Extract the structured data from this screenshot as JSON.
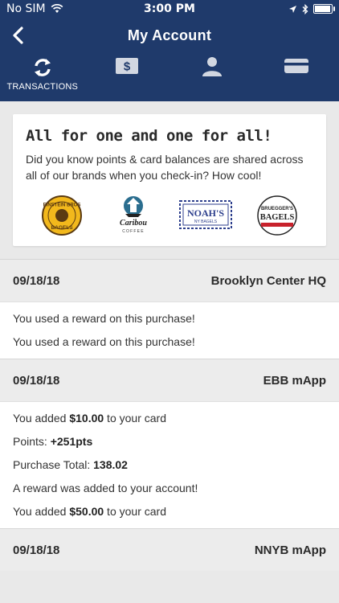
{
  "status": {
    "carrier": "No SIM",
    "time": "3:00 PM"
  },
  "nav": {
    "title": "My Account"
  },
  "tabs": [
    {
      "label": "TRANSACTIONS",
      "icon": "refresh-icon",
      "active": true
    },
    {
      "label": "",
      "icon": "dollar-bill-icon",
      "active": false
    },
    {
      "label": "",
      "icon": "person-icon",
      "active": false
    },
    {
      "label": "",
      "icon": "card-icon",
      "active": false
    }
  ],
  "promo": {
    "title": "All for one and one for all!",
    "text": "Did you know points & card balances are shared across all of our brands when you check-in? How cool!",
    "logos": [
      {
        "name": "einstein-bros-bagels-logo",
        "text_top": "EINSTEIN BROS",
        "text_bottom": "BAGELS"
      },
      {
        "name": "caribou-coffee-logo",
        "text_top": "Caribou",
        "text_bottom": "COFFEE"
      },
      {
        "name": "noahs-bagels-logo",
        "text_top": "NOAH'S",
        "text_bottom": "NY BAGELS"
      },
      {
        "name": "brueggers-bagels-logo",
        "text_top": "BRUEGGER'S",
        "text_bottom": "BAGELS"
      }
    ]
  },
  "transactions": [
    {
      "date": "09/18/18",
      "location": "Brooklyn Center HQ",
      "lines": [
        {
          "pre": "You used a reward on this purchase!",
          "bold": "",
          "post": ""
        },
        {
          "pre": "You used a reward on this purchase!",
          "bold": "",
          "post": ""
        }
      ]
    },
    {
      "date": "09/18/18",
      "location": "EBB mApp",
      "lines": [
        {
          "pre": "You added ",
          "bold": "$10.00",
          "post": " to your card"
        },
        {
          "pre": "Points: ",
          "bold": "+251pts",
          "post": ""
        },
        {
          "pre": "Purchase Total: ",
          "bold": "138.02",
          "post": ""
        },
        {
          "pre": "A reward was added to your account!",
          "bold": "",
          "post": ""
        },
        {
          "pre": "You added ",
          "bold": "$50.00",
          "post": " to your card"
        }
      ]
    },
    {
      "date": "09/18/18",
      "location": "NNYB mApp",
      "lines": []
    }
  ],
  "colors": {
    "header": "#1f3a6b",
    "background": "#e9e9e9"
  }
}
